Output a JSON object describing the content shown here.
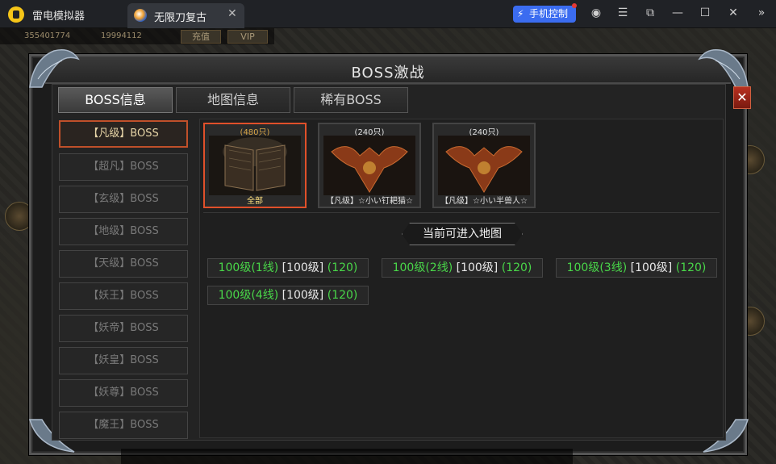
{
  "titlebar": {
    "app_name": "雷电模拟器",
    "tab_label": "无限刀复古",
    "tab_close": "✕",
    "phone_control": "手机控制",
    "icons": [
      "user-icon",
      "menu-icon",
      "external-icon",
      "minimize-icon",
      "maximize-icon",
      "close-icon",
      "collapse-icon"
    ]
  },
  "hud": {
    "gold": "355401774",
    "diamond": "19994112",
    "recharge": "充值",
    "vip": "VIP"
  },
  "panel": {
    "title": "BOSS激战",
    "close": "✕",
    "tabs": [
      {
        "label": "BOSS信息",
        "active": true
      },
      {
        "label": "地图信息",
        "active": false
      },
      {
        "label": "稀有BOSS",
        "active": false
      }
    ],
    "categories": [
      {
        "label": "【凡级】BOSS",
        "active": true
      },
      {
        "label": "【超凡】BOSS",
        "active": false
      },
      {
        "label": "【玄级】BOSS",
        "active": false
      },
      {
        "label": "【地级】BOSS",
        "active": false
      },
      {
        "label": "【天级】BOSS",
        "active": false
      },
      {
        "label": "【妖王】BOSS",
        "active": false
      },
      {
        "label": "【妖帝】BOSS",
        "active": false
      },
      {
        "label": "【妖皇】BOSS",
        "active": false
      },
      {
        "label": "【妖尊】BOSS",
        "active": false
      },
      {
        "label": "【魔王】BOSS",
        "active": false
      }
    ],
    "cards": [
      {
        "count": "(480只)",
        "label": "全部",
        "active": true
      },
      {
        "count": "(240只)",
        "label": "【凡级】☆小い钉耙猫☆",
        "active": false
      },
      {
        "count": "(240只)",
        "label": "【凡级】☆小い半兽人☆",
        "active": false
      }
    ],
    "map_header": "当前可进入地图",
    "maps": [
      {
        "name": "100级(1线)",
        "level": "[100级]",
        "count": "(120)"
      },
      {
        "name": "100级(2线)",
        "level": "[100级]",
        "count": "(120)"
      },
      {
        "name": "100级(3线)",
        "level": "[100级]",
        "count": "(120)"
      },
      {
        "name": "100级(4线)",
        "level": "[100级]",
        "count": "(120)"
      }
    ]
  },
  "colors": {
    "accent": "#e0502a",
    "map_green": "#49d749",
    "active_text": "#e8d6a8",
    "phone_btn": "#3b6cf0"
  }
}
